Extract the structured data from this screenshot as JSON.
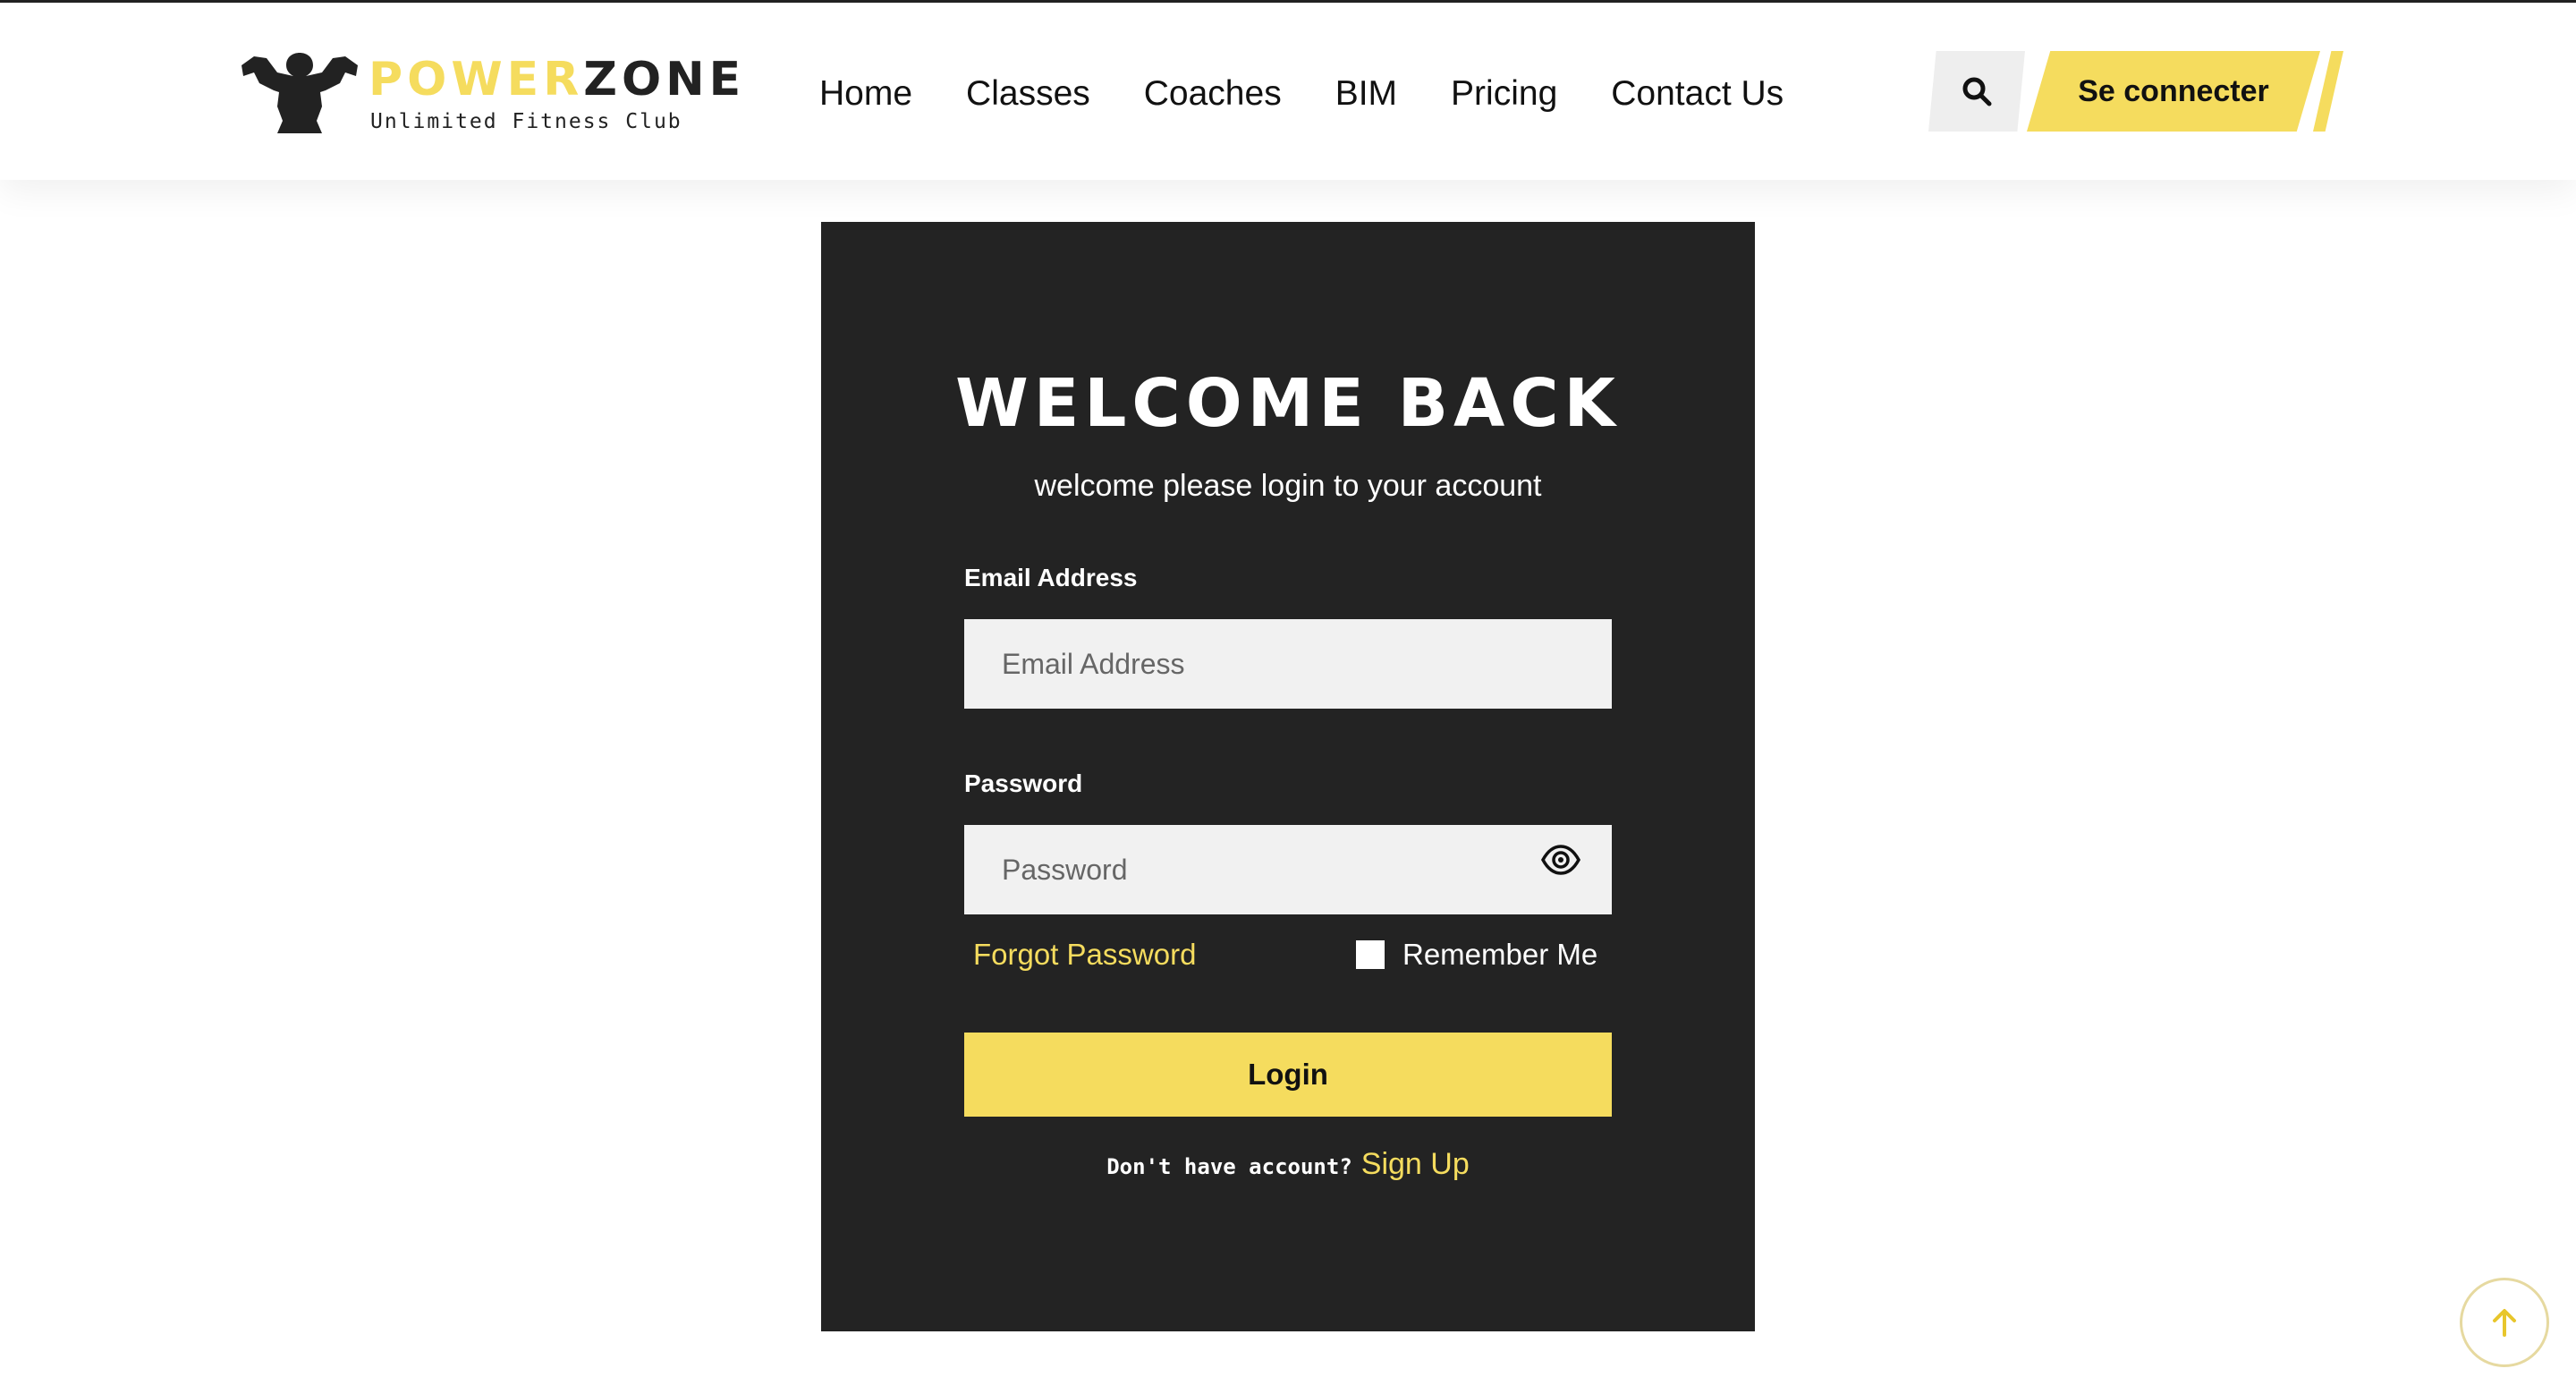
{
  "brand": {
    "name_part1": "POWER",
    "name_part2": "ZONE",
    "tagline": "Unlimited Fitness Club",
    "logo_icon": "bodybuilder-icon",
    "accent_color": "#f5dc5e",
    "dark_color": "#232323"
  },
  "nav": {
    "items": [
      {
        "label": "Home"
      },
      {
        "label": "Classes"
      },
      {
        "label": "Coaches"
      },
      {
        "label": "BIM"
      },
      {
        "label": "Pricing"
      },
      {
        "label": "Contact Us"
      }
    ],
    "search_icon": "search-icon",
    "connect_label": "Se connecter"
  },
  "login": {
    "title": "WELCOME BACK",
    "subtitle": "welcome please login to your account",
    "email_label": "Email Address",
    "email_placeholder": "Email Address",
    "email_value": "",
    "password_label": "Password",
    "password_placeholder": "Password",
    "password_value": "",
    "password_toggle_icon": "eye-icon",
    "forgot_label": "Forgot Password",
    "remember_label": "Remember Me",
    "remember_checked": false,
    "submit_label": "Login",
    "no_account_text": "Don't have account?",
    "signup_label": "Sign Up"
  },
  "scroll_top_icon": "arrow-up-icon"
}
